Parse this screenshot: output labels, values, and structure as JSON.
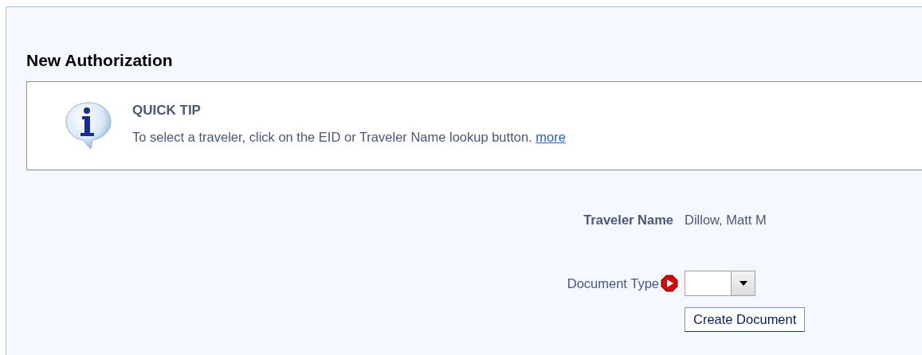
{
  "title": "New Authorization",
  "quick_tip": {
    "heading": "QUICK TIP",
    "text": "To select a traveler, click on the EID or Traveler Name lookup button.",
    "link": "more"
  },
  "fields": [
    {
      "kind": "readonly",
      "label": "Traveler Name",
      "value": "Dillow, Matt M"
    },
    {
      "kind": "select",
      "label": "Document Type",
      "required": true
    }
  ],
  "button": "Create Document"
}
